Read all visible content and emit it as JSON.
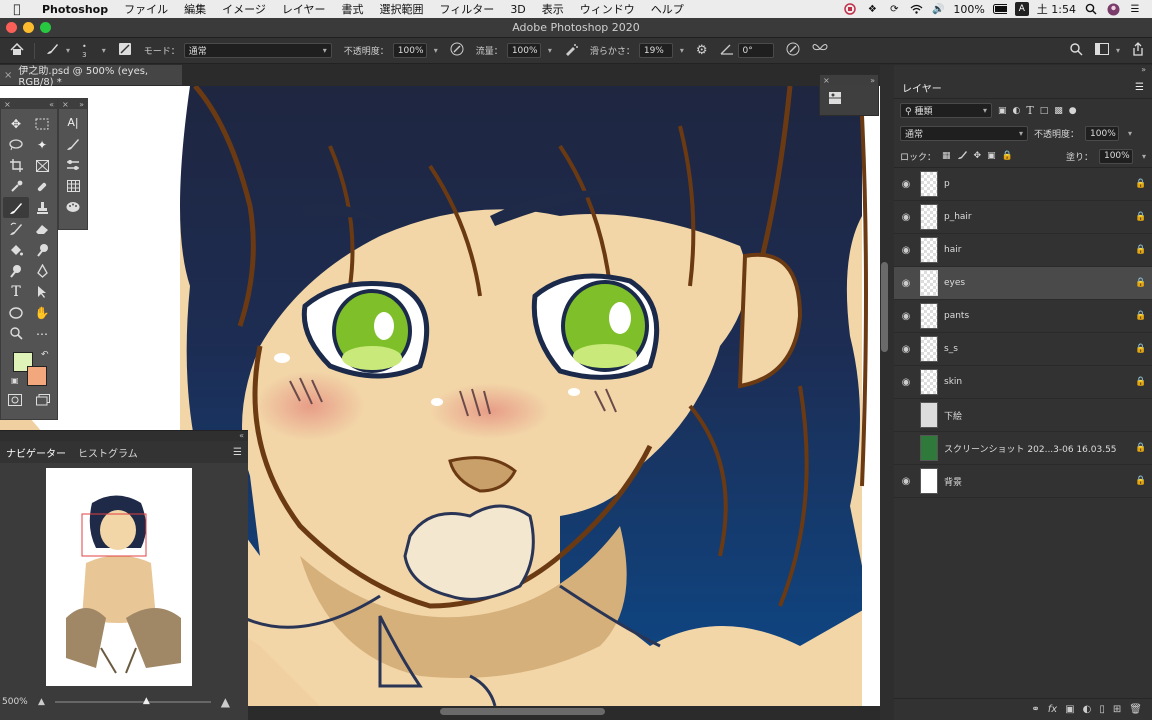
{
  "menubar": {
    "app": "Photoshop",
    "items": [
      "ファイル",
      "編集",
      "イメージ",
      "レイヤー",
      "書式",
      "選択範囲",
      "フィルター",
      "3D",
      "表示",
      "ウィンドウ",
      "ヘルプ"
    ],
    "battery": "100%",
    "clock": "土 1:54",
    "input_badge": "A"
  },
  "window": {
    "title": "Adobe Photoshop 2020"
  },
  "options": {
    "mode_label": "モード：",
    "mode_value": "通常",
    "opacity_label": "不透明度：",
    "opacity_value": "100%",
    "flow_label": "流量：",
    "flow_value": "100%",
    "smoothing_label": "滑らかさ：",
    "smoothing_value": "19%",
    "angle_value": "0°",
    "brush_size": "3"
  },
  "document": {
    "tab_label": "伊之助.psd @ 500% (eyes, RGB/8) *"
  },
  "navigator": {
    "tabs": [
      "ナビゲーター",
      "ヒストグラム"
    ],
    "zoom": "500%"
  },
  "layers_panel": {
    "title": "レイヤー",
    "filter_label": "種類",
    "blend_mode": "通常",
    "opacity_label": "不透明度：",
    "opacity_value": "100%",
    "lock_label": "ロック：",
    "fill_label": "塗り：",
    "fill_value": "100%",
    "layers": [
      {
        "name": "p",
        "visible": true,
        "locked": true
      },
      {
        "name": "p_hair",
        "visible": true,
        "locked": true
      },
      {
        "name": "hair",
        "visible": true,
        "locked": true
      },
      {
        "name": "eyes",
        "visible": true,
        "locked": true,
        "selected": true
      },
      {
        "name": "pants",
        "visible": true,
        "locked": true
      },
      {
        "name": "s_s",
        "visible": true,
        "locked": true
      },
      {
        "name": "skin",
        "visible": true,
        "locked": true
      },
      {
        "name": "下絵",
        "visible": false,
        "locked": false
      },
      {
        "name": "スクリーンショット 202...3-06 16.03.55",
        "visible": false,
        "locked": true
      },
      {
        "name": "背景",
        "visible": true,
        "locked": true
      }
    ]
  },
  "colors": {
    "foreground": "#dff2b8",
    "background": "#f2a87c",
    "accent": "#e04040"
  }
}
